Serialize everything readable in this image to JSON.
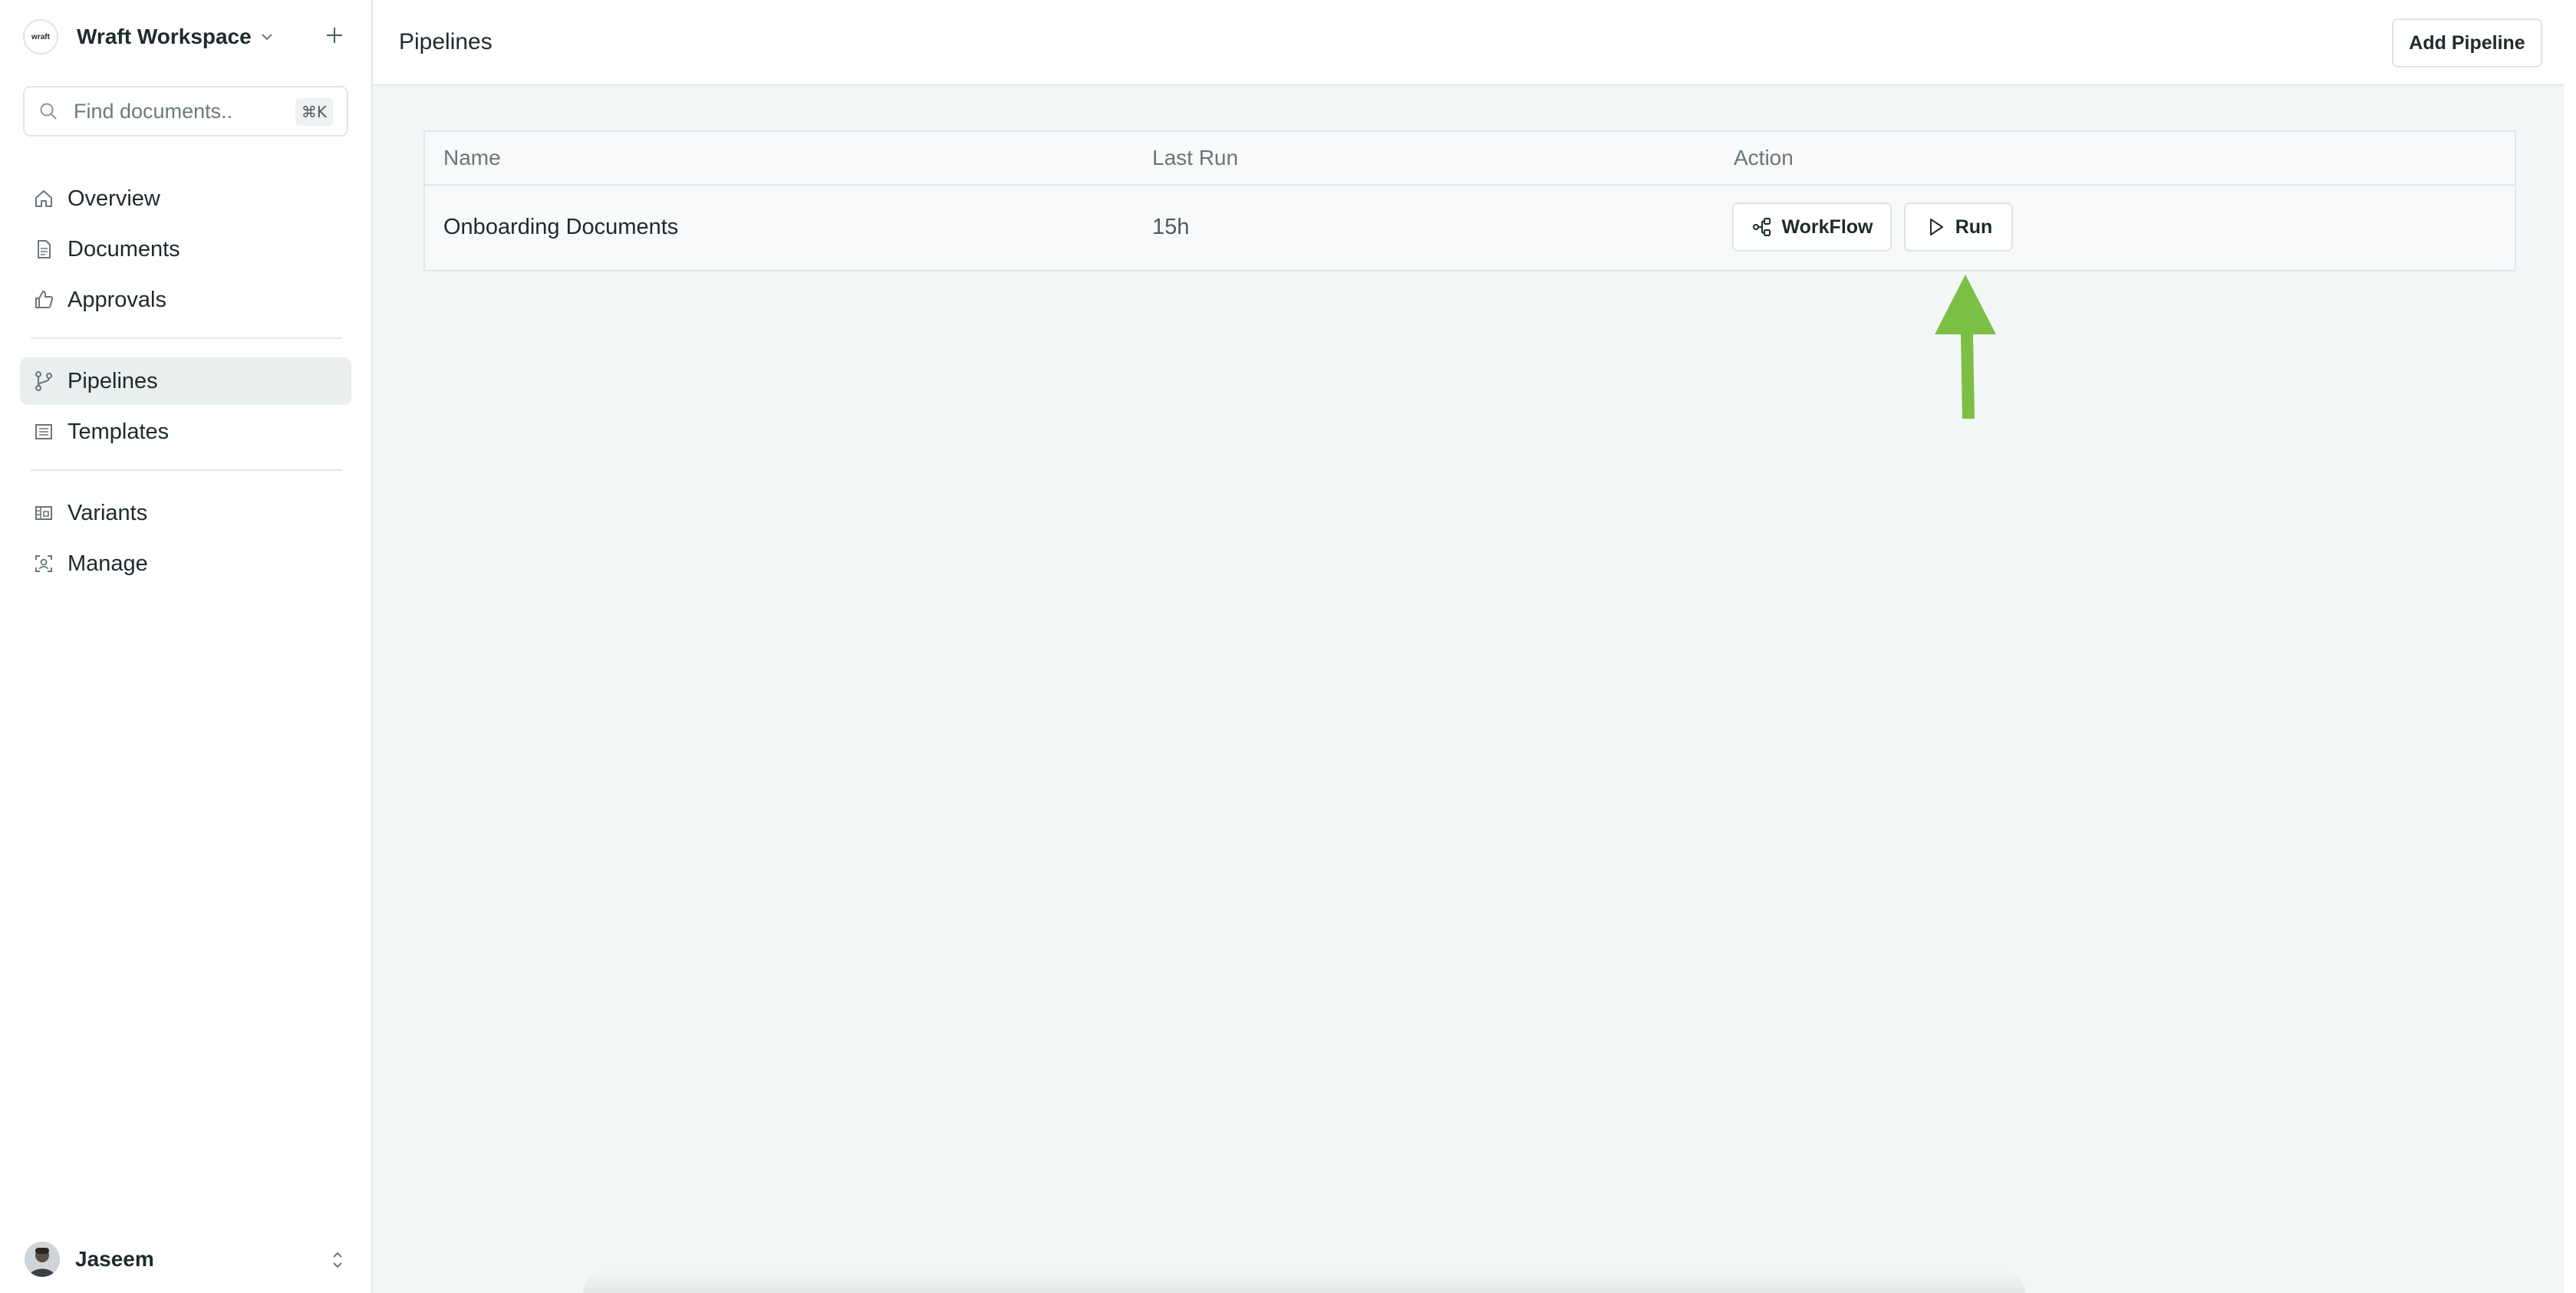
{
  "workspace": {
    "name": "Wraft Workspace",
    "logo_text": "wraft"
  },
  "search": {
    "placeholder": "Find documents..",
    "shortcut": "⌘K"
  },
  "sidebar": {
    "items": [
      {
        "label": "Overview",
        "icon": "home-icon"
      },
      {
        "label": "Documents",
        "icon": "document-icon"
      },
      {
        "label": "Approvals",
        "icon": "thumbs-up-icon"
      },
      {
        "label": "Pipelines",
        "icon": "git-branch-icon",
        "active": true
      },
      {
        "label": "Templates",
        "icon": "list-icon"
      },
      {
        "label": "Variants",
        "icon": "layout-icon"
      },
      {
        "label": "Manage",
        "icon": "user-square-icon"
      }
    ]
  },
  "user": {
    "name": "Jaseem"
  },
  "header": {
    "title": "Pipelines",
    "add_label": "Add Pipeline"
  },
  "table": {
    "columns": [
      "Name",
      "Last Run",
      "Action"
    ],
    "rows": [
      {
        "name": "Onboarding Documents",
        "last_run": "15h",
        "workflow_label": "WorkFlow",
        "run_label": "Run"
      }
    ]
  },
  "colors": {
    "accent_arrow": "#7bbf44",
    "active_bg": "#e9eeee",
    "border": "#e3e8ea"
  }
}
